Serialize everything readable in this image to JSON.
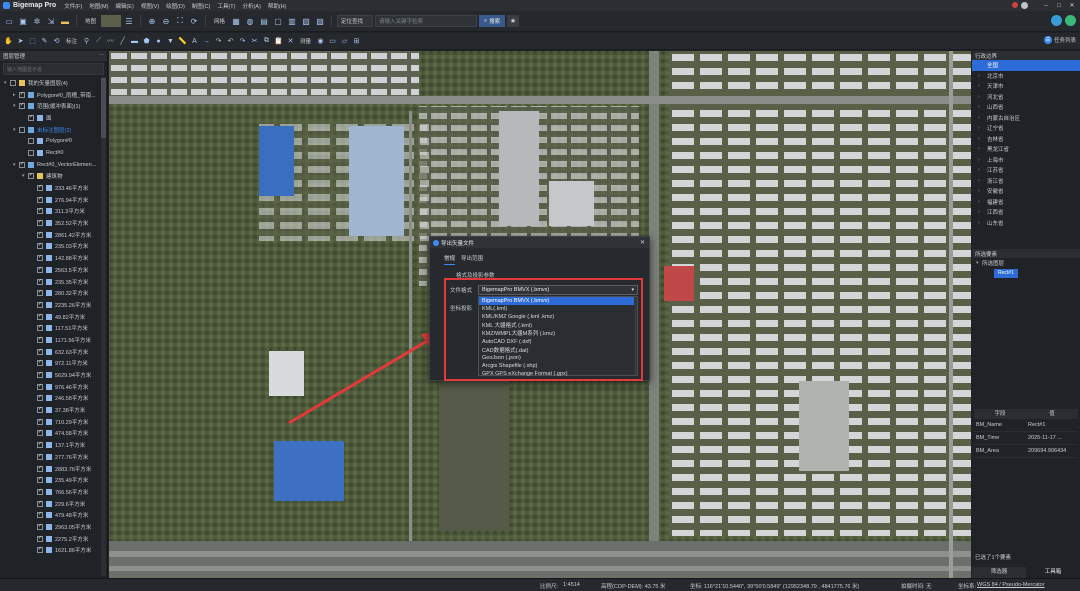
{
  "app": {
    "title": "Bigemap Pro"
  },
  "menu": [
    "文件(F)",
    "地图(M)",
    "编辑(E)",
    "视图(V)",
    "绘图(D)",
    "制图(C)",
    "工具(T)",
    "分析(A)",
    "帮助(H)"
  ],
  "toolbar1": {
    "map_label": "地图",
    "grid_label": "网格",
    "locate_select": "定位查找",
    "search_placeholder": "请输入关键字检索",
    "search_button": "搜索"
  },
  "toolbar2": {
    "label_draw": "标注",
    "label_measure": "测量",
    "task_button": "任务列表"
  },
  "left_panel": {
    "title": "图层管理",
    "search_placeholder": "输入地图显示名",
    "layers": [
      {
        "label": "我的矢量图层(4)",
        "level": 0,
        "arrow": "▾",
        "check": false,
        "icon": "folder"
      },
      {
        "label": "Polygon#0_雨槽_带南...",
        "level": 1,
        "arrow": "▸",
        "check": true,
        "icon": "layer"
      },
      {
        "label": "范围(缓冲表面)(1)",
        "level": 1,
        "arrow": "▾",
        "check": true,
        "icon": "layer"
      },
      {
        "label": "面",
        "level": 2,
        "arrow": "",
        "check": true,
        "icon": "polygon"
      },
      {
        "label": "未标注图层(2)",
        "level": 1,
        "arrow": "▾",
        "check": false,
        "icon": "layer",
        "highlight": true
      },
      {
        "label": "Polygon#0",
        "level": 2,
        "arrow": "",
        "check": false,
        "icon": "polygon"
      },
      {
        "label": "Rect#0",
        "level": 2,
        "arrow": "",
        "check": false,
        "icon": "polygon"
      },
      {
        "label": "Rect#0_VectorElemen...",
        "level": 1,
        "arrow": "▾",
        "check": true,
        "icon": "layer"
      },
      {
        "label": "建筑物",
        "level": 2,
        "arrow": "▾",
        "check": true,
        "icon": "folder"
      },
      {
        "label": "233.46平方米",
        "level": 3,
        "arrow": "",
        "check": true,
        "icon": "polygon"
      },
      {
        "label": "276.94平方米",
        "level": 3,
        "arrow": "",
        "check": true,
        "icon": "polygon"
      },
      {
        "label": "311.3平方米",
        "level": 3,
        "arrow": "",
        "check": true,
        "icon": "polygon"
      },
      {
        "label": "352.52平方米",
        "level": 3,
        "arrow": "",
        "check": true,
        "icon": "polygon"
      },
      {
        "label": "2861.42平方米",
        "level": 3,
        "arrow": "",
        "check": true,
        "icon": "polygon"
      },
      {
        "label": "235.03平方米",
        "level": 3,
        "arrow": "",
        "check": true,
        "icon": "polygon"
      },
      {
        "label": "142.88平方米",
        "level": 3,
        "arrow": "",
        "check": true,
        "icon": "polygon"
      },
      {
        "label": "2563.5平方米",
        "level": 3,
        "arrow": "",
        "check": true,
        "icon": "polygon"
      },
      {
        "label": "235.35平方米",
        "level": 3,
        "arrow": "",
        "check": true,
        "icon": "polygon"
      },
      {
        "label": "280.32平方米",
        "level": 3,
        "arrow": "",
        "check": true,
        "icon": "polygon"
      },
      {
        "label": "2235.26平方米",
        "level": 3,
        "arrow": "",
        "check": true,
        "icon": "polygon"
      },
      {
        "label": "49.82平方米",
        "level": 3,
        "arrow": "",
        "check": true,
        "icon": "polygon"
      },
      {
        "label": "117.51平方米",
        "level": 3,
        "arrow": "",
        "check": true,
        "icon": "polygon"
      },
      {
        "label": "1171.56平方米",
        "level": 3,
        "arrow": "",
        "check": true,
        "icon": "polygon"
      },
      {
        "label": "632.63平方米",
        "level": 3,
        "arrow": "",
        "check": true,
        "icon": "polygon"
      },
      {
        "label": "972.11平方米",
        "level": 3,
        "arrow": "",
        "check": true,
        "icon": "polygon"
      },
      {
        "label": "5629.94平方米",
        "level": 3,
        "arrow": "",
        "check": true,
        "icon": "polygon"
      },
      {
        "label": "976.46平方米",
        "level": 3,
        "arrow": "",
        "check": true,
        "icon": "polygon"
      },
      {
        "label": "246.58平方米",
        "level": 3,
        "arrow": "",
        "check": true,
        "icon": "polygon"
      },
      {
        "label": "37.38平方米",
        "level": 3,
        "arrow": "",
        "check": true,
        "icon": "polygon"
      },
      {
        "label": "710.29平方米",
        "level": 3,
        "arrow": "",
        "check": true,
        "icon": "polygon"
      },
      {
        "label": "474.58平方米",
        "level": 3,
        "arrow": "",
        "check": true,
        "icon": "polygon"
      },
      {
        "label": "137.1平方米",
        "level": 3,
        "arrow": "",
        "check": true,
        "icon": "polygon"
      },
      {
        "label": "277.76平方米",
        "level": 3,
        "arrow": "",
        "check": true,
        "icon": "polygon"
      },
      {
        "label": "2883.76平方米",
        "level": 3,
        "arrow": "",
        "check": true,
        "icon": "polygon"
      },
      {
        "label": "235.49平方米",
        "level": 3,
        "arrow": "",
        "check": true,
        "icon": "polygon"
      },
      {
        "label": "766.56平方米",
        "level": 3,
        "arrow": "",
        "check": true,
        "icon": "polygon"
      },
      {
        "label": "229.6平方米",
        "level": 3,
        "arrow": "",
        "check": true,
        "icon": "polygon"
      },
      {
        "label": "479.48平方米",
        "level": 3,
        "arrow": "",
        "check": true,
        "icon": "polygon"
      },
      {
        "label": "2963.05平方米",
        "level": 3,
        "arrow": "",
        "check": true,
        "icon": "polygon"
      },
      {
        "label": "2275.2平方米",
        "level": 3,
        "arrow": "",
        "check": true,
        "icon": "polygon"
      },
      {
        "label": "1621.86平方米",
        "level": 3,
        "arrow": "",
        "check": true,
        "icon": "polygon"
      }
    ]
  },
  "dialog": {
    "title": "导出矢量文件",
    "tabs": [
      "常规",
      "导出范围"
    ],
    "section": "格式及投影参数",
    "format_label": "文件格式",
    "projection_label": "坐标投影",
    "selected_format": "BigemapPro BMVX (.bmvx)",
    "options": [
      "BigemapPro BMVX (.bmvx)",
      "KML(.kml)",
      "KML/KMZ Google (.kml .kmz)",
      "KML 大疆格式 (.kml)",
      "KMZ/WMPL大疆M系列 (.kmz)",
      "AutoCAD DXF (.dxf)",
      "CAD数据格式(.dat)",
      "GeoJson (.json)",
      "Arcgis Shapefile (.shp)",
      "GPX GPS eXchange Format (.gpx)"
    ],
    "selected_index": 0
  },
  "right_panel": {
    "title": "行政边界",
    "regions": [
      "全国",
      "北京市",
      "天津市",
      "河北省",
      "山西省",
      "内蒙古自治区",
      "辽宁省",
      "吉林省",
      "黑龙江省",
      "上海市",
      "江苏省",
      "浙江省",
      "安徽省",
      "福建省",
      "江西省",
      "山东省"
    ],
    "selected_region": 0,
    "features_title": "所选要素",
    "features_layer": "所选图层",
    "feature_item": "Rect#1",
    "attr_headers": [
      "字段",
      "值"
    ],
    "attributes": [
      {
        "key": "BM_Name",
        "value": "Rect#1"
      },
      {
        "key": "BM_Time",
        "value": "2025-11-17 ..."
      },
      {
        "key": "BM_Area",
        "value": "209694.906434"
      }
    ],
    "selected_count": "已选了1个要素",
    "bottom_tabs": [
      "筛选器",
      "工具箱"
    ]
  },
  "statusbar": {
    "scale_label": "比例尺:",
    "scale_value": "1:4514",
    "elevation": "高程(COP-DEM): 43.75 米",
    "coords": "坐标: 116°21'10.5440\", 39°50'0.5849\" (12952348.79 , 4841775.76 米)",
    "zoom": "拍摄时间: 无",
    "crs_label": "坐标系:",
    "crs_value": "WGS 84 / Pseudo-Mercator"
  },
  "colors": {
    "accent": "#2d6bd6",
    "highlight_box": "#e03a3a",
    "panel_bg": "#1f2227"
  }
}
